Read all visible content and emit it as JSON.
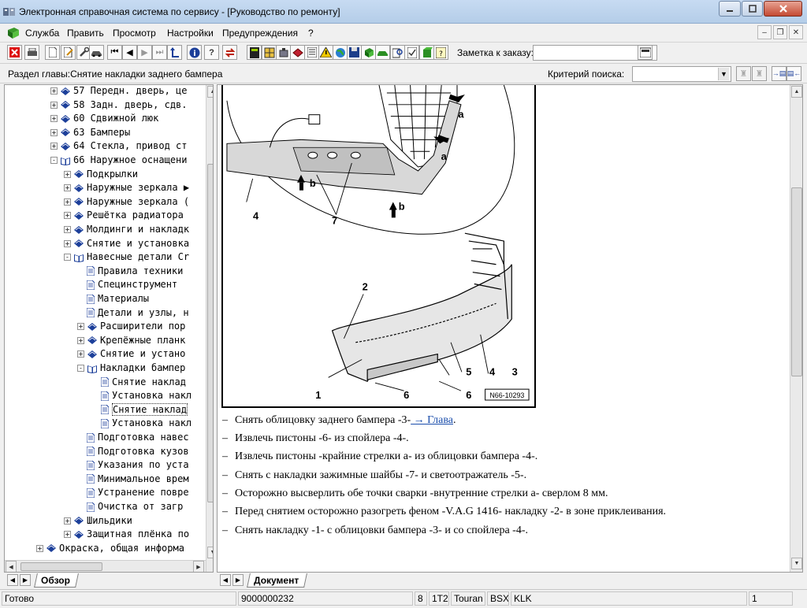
{
  "window": {
    "title": "Электронная справочная система по сервису - [Руководство по ремонту]"
  },
  "menu": {
    "items": [
      "Служба",
      "Править",
      "Просмотр",
      "Настройки",
      "Предупреждения",
      "?"
    ]
  },
  "toolbar": {
    "order_label": "Заметка к заказу:",
    "order_value": ""
  },
  "section": {
    "label": "Раздел главы:Снятие накладки заднего бампера",
    "criteria_label": "Критерий  поиска:",
    "criteria_value": ""
  },
  "tree": {
    "items": [
      {
        "label": "57 Передн. дверь, це",
        "kind": "book",
        "exp": "+"
      },
      {
        "label": "58 Задн. дверь, сдв.",
        "kind": "book",
        "exp": "+"
      },
      {
        "label": "60 Сдвижной люк",
        "kind": "book",
        "exp": "+"
      },
      {
        "label": "63 Бамперы",
        "kind": "book",
        "exp": "+"
      },
      {
        "label": "64 Стекла, привод ст",
        "kind": "book",
        "exp": "+"
      },
      {
        "label": "66 Наружное оснащени",
        "kind": "openbook",
        "exp": "-"
      },
      {
        "label": "Подкрылки",
        "kind": "book",
        "exp": "+"
      },
      {
        "label": "Наружные зеркала ▶",
        "kind": "book",
        "exp": "+"
      },
      {
        "label": "Наружные зеркала (",
        "kind": "book",
        "exp": "+"
      },
      {
        "label": "Решётка радиатора",
        "kind": "book",
        "exp": "+"
      },
      {
        "label": "Молдинги и накладк",
        "kind": "book",
        "exp": "+"
      },
      {
        "label": "Снятие и установка",
        "kind": "book",
        "exp": "+"
      },
      {
        "label": "Навесные детали Cr",
        "kind": "openbook",
        "exp": "-"
      },
      {
        "label": "Правила техники",
        "kind": "page",
        "exp": ""
      },
      {
        "label": "Специнструмент",
        "kind": "page",
        "exp": ""
      },
      {
        "label": "Материалы",
        "kind": "page",
        "exp": ""
      },
      {
        "label": "Детали и узлы, н",
        "kind": "page",
        "exp": ""
      },
      {
        "label": "Расширители пор",
        "kind": "book",
        "exp": "+"
      },
      {
        "label": "Крепёжные планк",
        "kind": "book",
        "exp": "+"
      },
      {
        "label": "Снятие и устано",
        "kind": "book",
        "exp": "+"
      },
      {
        "label": "Накладки бампер",
        "kind": "openbook",
        "exp": "-"
      },
      {
        "label": "Снятие наклад",
        "kind": "page",
        "exp": ""
      },
      {
        "label": "Установка накл",
        "kind": "page",
        "exp": ""
      },
      {
        "label": "Снятие наклад",
        "kind": "page",
        "exp": "",
        "selected": true
      },
      {
        "label": "Установка накл",
        "kind": "page",
        "exp": ""
      },
      {
        "label": "Подготовка навес",
        "kind": "page",
        "exp": ""
      },
      {
        "label": "Подготовка кузов",
        "kind": "page",
        "exp": ""
      },
      {
        "label": "Указания по уста",
        "kind": "page",
        "exp": ""
      },
      {
        "label": "Минимальное врем",
        "kind": "page",
        "exp": ""
      },
      {
        "label": "Устранение повре",
        "kind": "page",
        "exp": ""
      },
      {
        "label": "Очистка от загр",
        "kind": "page",
        "exp": ""
      },
      {
        "label": "Шильдики",
        "kind": "book",
        "exp": "+"
      },
      {
        "label": "Защитная плёнка по",
        "kind": "book",
        "exp": "+"
      },
      {
        "label": "Окраска, общая информа",
        "kind": "book",
        "exp": "+"
      }
    ]
  },
  "tabs": {
    "left": "Обзор",
    "right": "Документ"
  },
  "figure": {
    "callouts": [
      "a",
      "a",
      "b",
      "b",
      "4",
      "7",
      "2",
      "1",
      "6",
      "6",
      "5",
      "4",
      "3"
    ],
    "code": "N66-10293"
  },
  "steps": [
    {
      "text": "Снять облицовку заднего бампера -3-",
      "link": " → Глава",
      "tail": "."
    },
    {
      "text": "Извлечь пистоны -6- из спойлера -4-.",
      "link": "",
      "tail": ""
    },
    {
      "text": "Извлечь пистоны -крайние стрелки а- из облицовки бампера -4-.",
      "link": "",
      "tail": ""
    },
    {
      "text": "Снять с накладки зажимные шайбы -7- и светоотражатель -5-.",
      "link": "",
      "tail": ""
    },
    {
      "text": "Осторожно высверлить обе точки сварки -внутренние стрелки а- сверлом 8 мм.",
      "link": "",
      "tail": ""
    },
    {
      "text": "Перед снятием осторожно разогреть феном -V.A.G 1416- накладку -2- в зоне приклеивания.",
      "link": "",
      "tail": ""
    },
    {
      "text": "Снять накладку -1- с облицовки бампера -3- и со спойлера -4-.",
      "link": "",
      "tail": ""
    }
  ],
  "statusbar": {
    "status": "Готово",
    "vin": "9000000232",
    "c1": "8",
    "c2": "1T2",
    "model": "Touran",
    "engine": "BSX",
    "gearbox": "KLK",
    "page": "1"
  }
}
